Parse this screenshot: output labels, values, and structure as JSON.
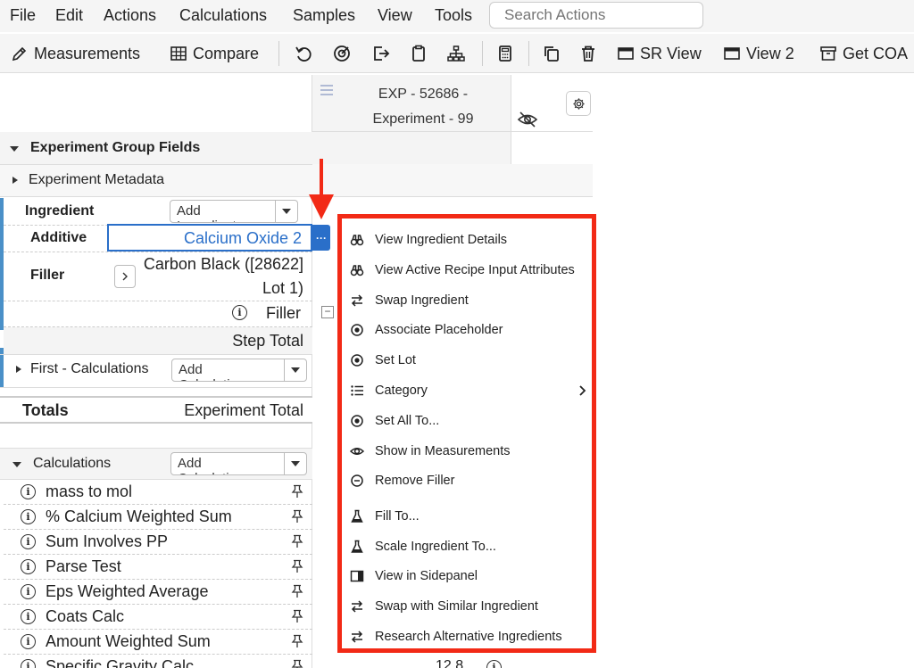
{
  "menubar": {
    "items": [
      "File",
      "Edit",
      "Actions",
      "Calculations",
      "Samples",
      "View",
      "Tools"
    ],
    "search_placeholder": "Search Actions"
  },
  "toolbar": {
    "measurements": "Measurements",
    "compare": "Compare",
    "sr_view": "SR View",
    "view2": "View 2",
    "get_coa": "Get COA"
  },
  "experiment": {
    "header": "EXP - 52686 - Experiment - 99"
  },
  "groups": {
    "group_fields": "Experiment Group Fields",
    "metadata": "Experiment Metadata"
  },
  "ingredients": {
    "label": "Ingredient",
    "add_button": "Add Ingredients",
    "additive_label": "Additive",
    "additive_value": "Calcium Oxide 2",
    "filler_label": "Filler",
    "filler_value": "Carbon Black ([28622] Lot 1)",
    "filler_sub": "Filler",
    "step_total": "Step Total"
  },
  "first_calcs": {
    "label": "First - Calculations",
    "add_button": "Add Calculations"
  },
  "totals": {
    "label": "Totals",
    "value": "Experiment Total"
  },
  "calculations": {
    "label": "Calculations",
    "add_button": "Add Calculations",
    "items": [
      "mass to mol",
      "% Calcium Weighted Sum",
      "Sum Involves PP",
      "Parse Test",
      "Eps Weighted Average",
      "Coats Calc",
      "Amount Weighted Sum",
      "Specific Gravity Calc"
    ],
    "partial_value": "12.8"
  },
  "context_menu": {
    "items": [
      {
        "label": "View Ingredient Details",
        "icon": "binoculars-icon"
      },
      {
        "label": "View Active Recipe Input Attributes",
        "icon": "binoculars-icon"
      },
      {
        "label": "Swap Ingredient",
        "icon": "swap-icon"
      },
      {
        "label": "Associate Placeholder",
        "icon": "radio-dot-icon"
      },
      {
        "label": "Set Lot",
        "icon": "radio-dot-icon"
      },
      {
        "label": "Category",
        "icon": "list-icon"
      },
      {
        "label": "Set All To...",
        "icon": "radio-dot-icon"
      },
      {
        "label": "Show in Measurements",
        "icon": "eye-icon"
      },
      {
        "label": "Remove Filler",
        "icon": "minus-circle-icon"
      },
      {
        "label": "Fill To...",
        "icon": "flask-icon"
      },
      {
        "label": "Scale Ingredient To...",
        "icon": "flask-icon"
      },
      {
        "label": "View in Sidepanel",
        "icon": "sidepanel-icon"
      },
      {
        "label": "Swap with Similar Ingredient",
        "icon": "swap-icon"
      },
      {
        "label": "Research Alternative Ingredients",
        "icon": "swap-icon"
      }
    ]
  },
  "colors": {
    "highlight_border": "#f22a16",
    "accent_blue": "#2a6fc9",
    "left_accent": "#4a90c8"
  }
}
